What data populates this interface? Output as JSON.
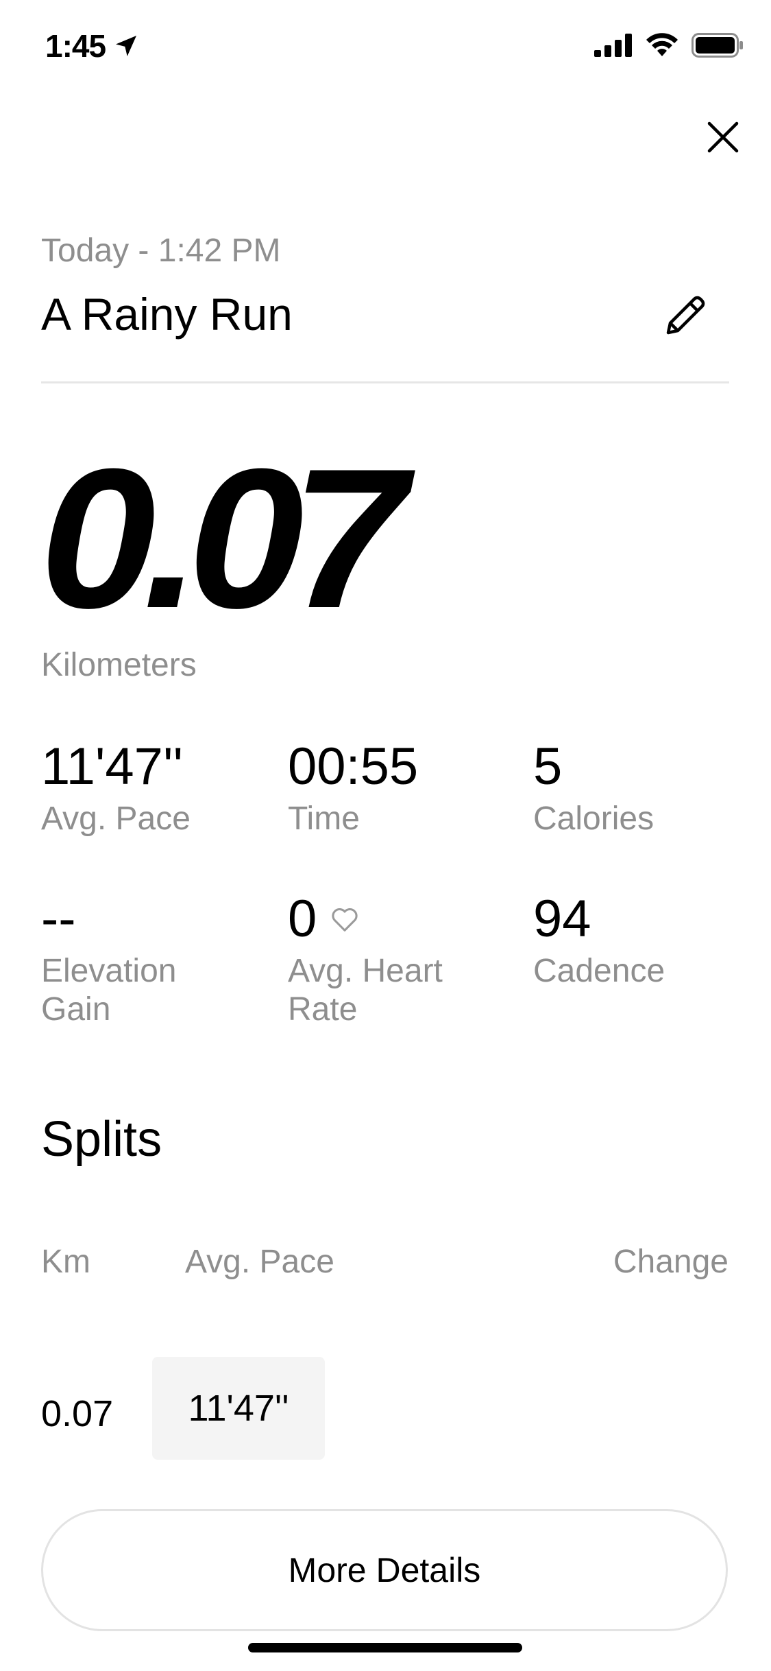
{
  "status_bar": {
    "time": "1:45"
  },
  "activity": {
    "date": "Today - 1:42 PM",
    "title": "A Rainy Run",
    "distance": "0.07",
    "distance_unit": "Kilometers"
  },
  "stats": {
    "avg_pace": {
      "value": "11'47''",
      "label": "Avg. Pace"
    },
    "time": {
      "value": "00:55",
      "label": "Time"
    },
    "calories": {
      "value": "5",
      "label": "Calories"
    },
    "elevation": {
      "value": "--",
      "label_line1": "Elevation",
      "label_line2": "Gain"
    },
    "heart_rate": {
      "value": "0",
      "label_line1": "Avg. Heart",
      "label_line2": "Rate"
    },
    "cadence": {
      "value": "94",
      "label": "Cadence"
    }
  },
  "splits": {
    "title": "Splits",
    "headers": {
      "km": "Km",
      "pace": "Avg. Pace",
      "change": "Change"
    },
    "rows": [
      {
        "km": "0.07",
        "pace": "11'47''"
      }
    ]
  },
  "buttons": {
    "more_details": "More Details"
  },
  "colors": {
    "primary_text": "#000000",
    "secondary_text": "#8e8e8e",
    "divider": "#e6e6e6",
    "split_bar": "#f4f4f4"
  }
}
